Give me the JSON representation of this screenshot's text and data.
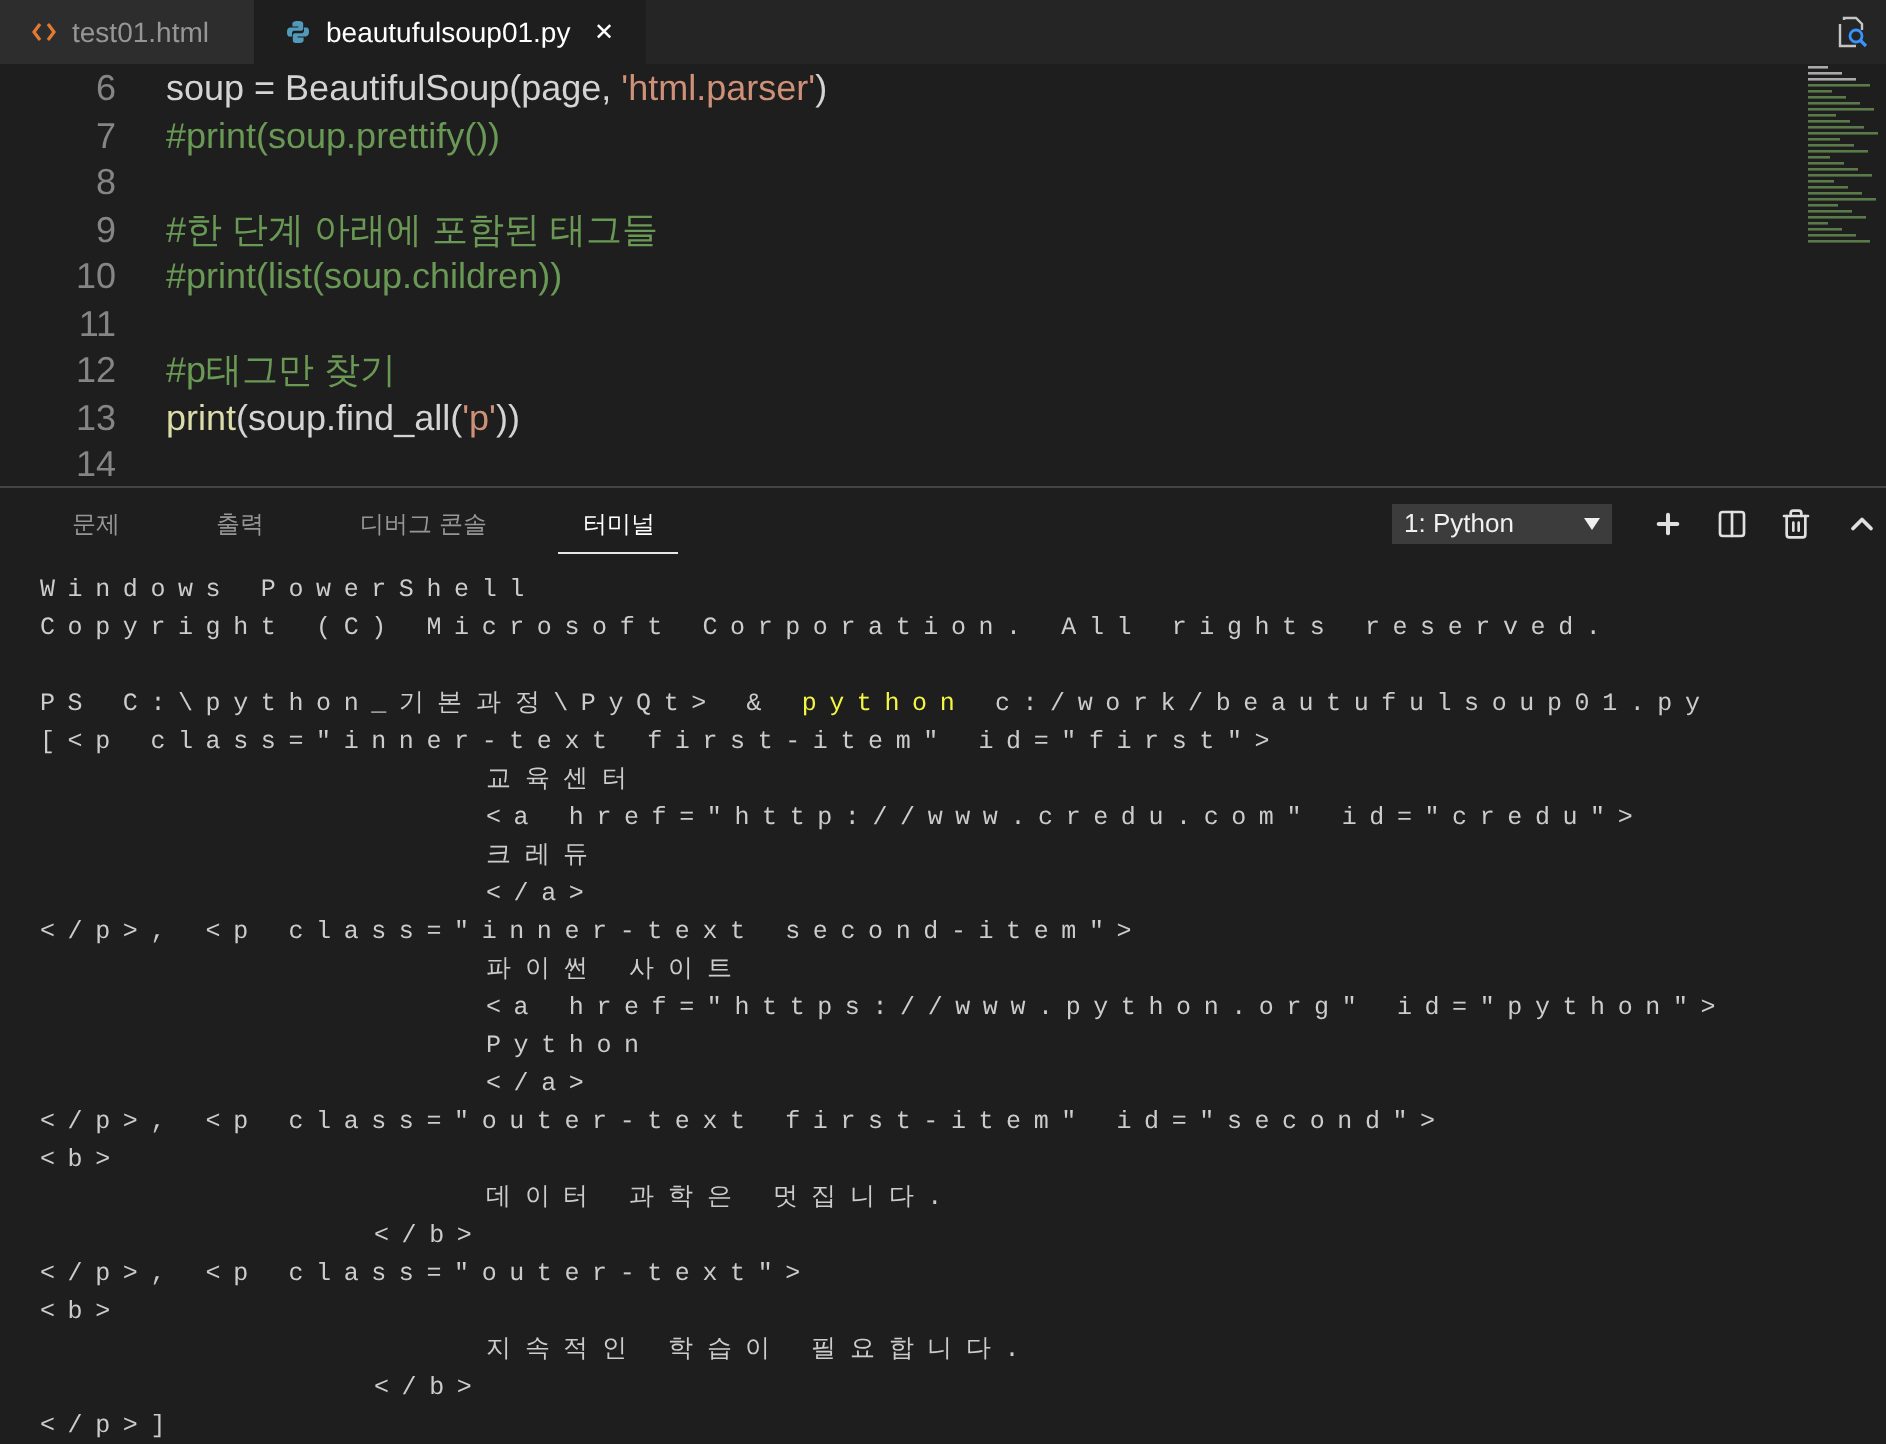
{
  "tabs": [
    {
      "label": "test01.html",
      "kind": "html",
      "selected": false
    },
    {
      "label": "beautufulsoup01.py",
      "kind": "python",
      "selected": true,
      "close": "✕"
    }
  ],
  "editor": {
    "lines": [
      {
        "number": "6",
        "tokens": [
          {
            "kind": "plain",
            "text": "soup = BeautifulSoup(page, "
          },
          {
            "kind": "string",
            "text": "'html.parser'"
          },
          {
            "kind": "plain",
            "text": ")"
          }
        ]
      },
      {
        "number": "7",
        "tokens": [
          {
            "kind": "comment",
            "text": "#print(soup.prettify())"
          }
        ]
      },
      {
        "number": "8"
      },
      {
        "number": "9",
        "tokens": [
          {
            "kind": "comment",
            "text": "#한 단계 아래에 포함된 태그들"
          }
        ]
      },
      {
        "number": "10",
        "tokens": [
          {
            "kind": "comment",
            "text": "#print(list(soup.children))"
          }
        ]
      },
      {
        "number": "11"
      },
      {
        "number": "12",
        "tokens": [
          {
            "kind": "comment",
            "text": "#p태그만 찾기"
          }
        ]
      },
      {
        "number": "13",
        "tokens": [
          {
            "kind": "function",
            "text": "print"
          },
          {
            "kind": "plain",
            "text": "(soup.find_all("
          },
          {
            "kind": "string",
            "text": "'p'"
          },
          {
            "kind": "plain",
            "text": "))"
          }
        ]
      },
      {
        "number": "14"
      }
    ]
  },
  "panel": {
    "tabs": [
      {
        "label": "문제",
        "selected": false
      },
      {
        "label": "출력",
        "selected": false
      },
      {
        "label": "디버그 콘솔",
        "selected": false
      },
      {
        "label": "터미널",
        "selected": true
      }
    ],
    "terminal_select": {
      "value": "1: Python"
    }
  },
  "terminal": {
    "lines": [
      {
        "kind": "plain",
        "segments": [
          {
            "kind": "plain",
            "text": "Windows PowerShell"
          }
        ]
      },
      {
        "kind": "plain",
        "segments": [
          {
            "kind": "plain",
            "text": "Copyright (C) Microsoft Corporation. All rights reserved."
          }
        ]
      },
      {
        "kind": "blank"
      },
      {
        "kind": "plain",
        "segments": [
          {
            "kind": "plain",
            "text": "PS C:\\python_기본과정\\PyQt> & "
          },
          {
            "kind": "command",
            "text": "python"
          },
          {
            "kind": "plain",
            "text": " c:/work/beautufulsoup01.py"
          }
        ]
      },
      {
        "kind": "plain",
        "segments": [
          {
            "kind": "plain",
            "text": "[<p class=\"inner-text first-item\" id=\"first\">"
          }
        ]
      },
      {
        "kind": "deep",
        "segments": [
          {
            "kind": "plain",
            "text": "교육센터"
          }
        ]
      },
      {
        "kind": "deep",
        "segments": [
          {
            "kind": "plain",
            "text": "<a href=\"http://www.credu.com\" id=\"credu\">"
          }
        ]
      },
      {
        "kind": "deep",
        "segments": [
          {
            "kind": "plain",
            "text": "크레듀"
          }
        ]
      },
      {
        "kind": "deep",
        "segments": [
          {
            "kind": "plain",
            "text": "</a>"
          }
        ]
      },
      {
        "kind": "plain",
        "segments": [
          {
            "kind": "plain",
            "text": "</p>, <p class=\"inner-text second-item\">"
          }
        ]
      },
      {
        "kind": "deep",
        "segments": [
          {
            "kind": "plain",
            "text": "파이썬 사이트"
          }
        ]
      },
      {
        "kind": "deep",
        "segments": [
          {
            "kind": "plain",
            "text": "<a href=\"https://www.python.org\" id=\"python\">"
          }
        ]
      },
      {
        "kind": "deep",
        "segments": [
          {
            "kind": "plain",
            "text": "Python"
          }
        ]
      },
      {
        "kind": "deep",
        "segments": [
          {
            "kind": "plain",
            "text": "</a>"
          }
        ]
      },
      {
        "kind": "plain",
        "segments": [
          {
            "kind": "plain",
            "text": "</p>, <p class=\"outer-text first-item\" id=\"second\">"
          }
        ]
      },
      {
        "kind": "plain",
        "segments": [
          {
            "kind": "plain",
            "text": "<b>"
          }
        ]
      },
      {
        "kind": "deep",
        "segments": [
          {
            "kind": "plain",
            "text": "데이터 과학은 멋집니다."
          }
        ]
      },
      {
        "kind": "mid",
        "segments": [
          {
            "kind": "plain",
            "text": "</b>"
          }
        ]
      },
      {
        "kind": "plain",
        "segments": [
          {
            "kind": "plain",
            "text": "</p>, <p class=\"outer-text\">"
          }
        ]
      },
      {
        "kind": "plain",
        "segments": [
          {
            "kind": "plain",
            "text": "<b>"
          }
        ]
      },
      {
        "kind": "deep",
        "segments": [
          {
            "kind": "plain",
            "text": "지속적인 학습이 필요합니다."
          }
        ]
      },
      {
        "kind": "mid",
        "segments": [
          {
            "kind": "plain",
            "text": "</b>"
          }
        ]
      },
      {
        "kind": "plain",
        "segments": [
          {
            "kind": "plain",
            "text": "</p>]"
          }
        ]
      }
    ]
  }
}
